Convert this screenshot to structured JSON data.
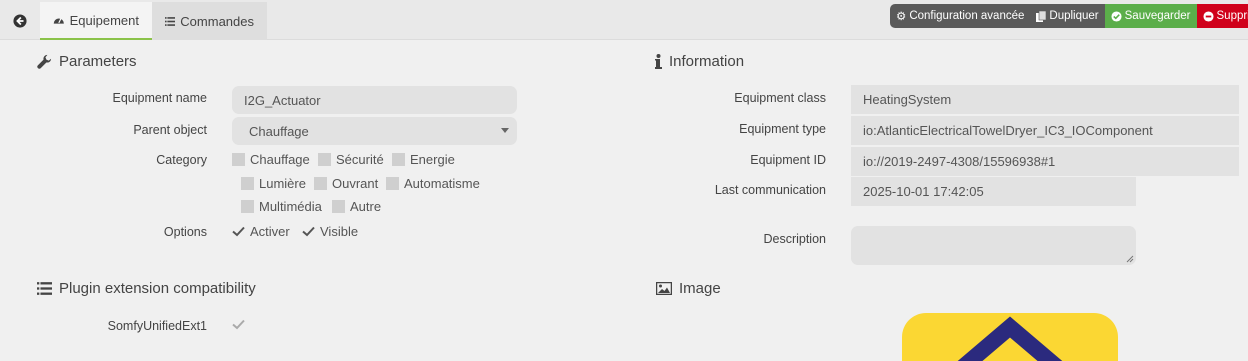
{
  "tabs": [
    {
      "label": "Equipement",
      "icon": "dashboard-icon"
    },
    {
      "label": "Commandes",
      "icon": "list-icon"
    }
  ],
  "actions": {
    "config": "Configuration avancée",
    "duplicate": "Dupliquer",
    "save": "Sauvegarder",
    "delete": "Supprimer"
  },
  "parameters": {
    "title": "Parameters",
    "equipment_name_label": "Equipment name",
    "equipment_name_value": "I2G_Actuator",
    "parent_label": "Parent object",
    "parent_value": "Chauffage",
    "category_label": "Category",
    "categories": [
      "Chauffage",
      "Sécurité",
      "Energie",
      "Lumière",
      "Ouvrant",
      "Automatisme",
      "Multimédia",
      "Autre"
    ],
    "options_label": "Options",
    "options": [
      {
        "label": "Activer",
        "checked": true
      },
      {
        "label": "Visible",
        "checked": true
      }
    ]
  },
  "plugin": {
    "title": "Plugin extension compatibility",
    "items": [
      {
        "label": "SomfyUnifiedExt1",
        "checked": true
      }
    ]
  },
  "information": {
    "title": "Information",
    "class_label": "Equipment class",
    "class_value": "HeatingSystem",
    "type_label": "Equipment type",
    "type_value": "io:AtlanticElectricalTowelDryer_IC3_IOComponent",
    "id_label": "Equipment ID",
    "id_value": "io://2019-2497-4308/15596938#1",
    "lastcomm_label": "Last communication",
    "lastcomm_value": "2025-10-01 17:42:05",
    "description_label": "Description",
    "description_value": ""
  },
  "image": {
    "title": "Image"
  },
  "colors": {
    "active_tab_border": "#8bc34a",
    "save": "#5bae4a",
    "delete": "#d0011b",
    "dark_btn": "#5a5a5a"
  }
}
